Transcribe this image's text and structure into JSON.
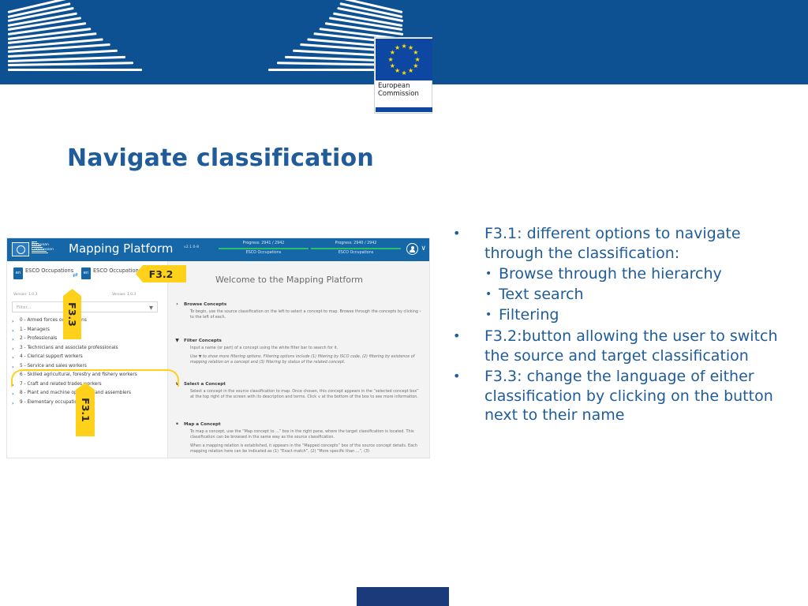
{
  "banner": {
    "logo_line1": "European",
    "logo_line2": "Commission",
    "background_color": "#0e5193"
  },
  "slide": {
    "title": "Navigate classification",
    "title_color": "#1f5c99"
  },
  "screenshot": {
    "topbar": {
      "app_title": "Mapping Platform",
      "ec_mark_line1": "European",
      "ec_mark_line2": "Commission",
      "version": "v2.1.0-8",
      "progress_left": {
        "label": "Progress: 2941 / 2942",
        "classification": "ESCO Occupations"
      },
      "progress_right": {
        "label": "Progress: 2940 / 2942",
        "classification": "ESCO Occupations"
      },
      "avatar_icon": "user-circle-icon",
      "avatar_chevron": "∨"
    },
    "source_classification": {
      "language_badge": "en",
      "name": "ESCO Occupations",
      "version": "Version: 1.0.3"
    },
    "target_classification": {
      "language_badge": "en",
      "name": "ESCO Occupations",
      "version": "Version: 1.0.3"
    },
    "swap_icon": "⇄",
    "filter": {
      "placeholder": "Filter...",
      "funnel_icon": "▼"
    },
    "tree_items": [
      {
        "chevron": "›",
        "label": "0 - Armed forces occupations"
      },
      {
        "chevron": "›",
        "label": "1 - Managers"
      },
      {
        "chevron": "›",
        "label": "2 - Professionals"
      },
      {
        "chevron": "›",
        "label": "3 - Technicians and associate professionals"
      },
      {
        "chevron": "›",
        "label": "4 - Clerical support workers"
      },
      {
        "chevron": "›",
        "label": "5 - Service and sales workers"
      },
      {
        "chevron": "›",
        "label": "6 - Skilled agricultural, forestry and fishery workers"
      },
      {
        "chevron": "›",
        "label": "7 - Craft and related trades workers"
      },
      {
        "chevron": "›",
        "label": "8 - Plant and machine operators and assemblers"
      },
      {
        "chevron": "›",
        "label": "9 - Elementary occupations"
      }
    ],
    "welcome_title": "Welcome to the Mapping Platform",
    "sections": [
      {
        "icon": "›",
        "icon_name": "chevron-right-icon",
        "title": "Browse Concepts",
        "paragraphs": [
          "To begin, use the source classification on the left to select a concept to map. Browse through the concepts by clicking › to the left of each."
        ]
      },
      {
        "icon": "▼",
        "icon_name": "funnel-icon",
        "title": "Filter Concepts",
        "paragraphs": [
          "Input a name (or part) of a concept using the white filter bar to search for it."
        ],
        "italic_paragraphs": [
          "Use ▼ to show more filtering options. Filtering options include (1) filtering by ISCO code, (2) filtering by existence of mapping relation on a concept and (3) filtering by status of the related concept."
        ]
      },
      {
        "icon": "∨",
        "icon_name": "chevron-down-icon",
        "title": "Select a Concept",
        "paragraphs": [
          "Select a concept in the source classification to map. Once chosen, this concept appears in the “selected concept box” at the top right of the screen with its description and terms. Click ∨ at the bottom of the box to see more information."
        ]
      },
      {
        "icon": "⚭",
        "icon_name": "link-icon",
        "title": "Map a Concept",
        "paragraphs": [
          "To map a concept, use the “Map concept to ...” box in the right pane, where the target classification is located. This classification can be browsed in the same way as the source classification.",
          "When a mapping relation is established, it appears in the “Mapped concepts” box of the source concept details. Each mapping relation here can be indicated as (1) “Exact match”, (2) “More specific than ...”, (3)"
        ]
      }
    ],
    "callouts": [
      {
        "id": "f32",
        "label": "F3.2"
      },
      {
        "id": "f33",
        "label": "F3.3"
      },
      {
        "id": "f31",
        "label": "F3.1"
      }
    ]
  },
  "bullets": [
    {
      "marker": "•",
      "text": "F3.1: different options to navigate through the classification:",
      "sub_items": [
        {
          "marker": "•",
          "text": "Browse through the hierarchy"
        },
        {
          "marker": "•",
          "text": "Text search"
        },
        {
          "marker": "•",
          "text": "Filtering"
        }
      ]
    },
    {
      "marker": "•",
      "text": "F3.2:button allowing the user to switch the source and target classification",
      "sub_items": []
    },
    {
      "marker": "•",
      "text": "F3.3: change the language of either classification by clicking on the button next to their name",
      "sub_items": []
    }
  ],
  "bottom_bar_color": "#1b3a7a"
}
